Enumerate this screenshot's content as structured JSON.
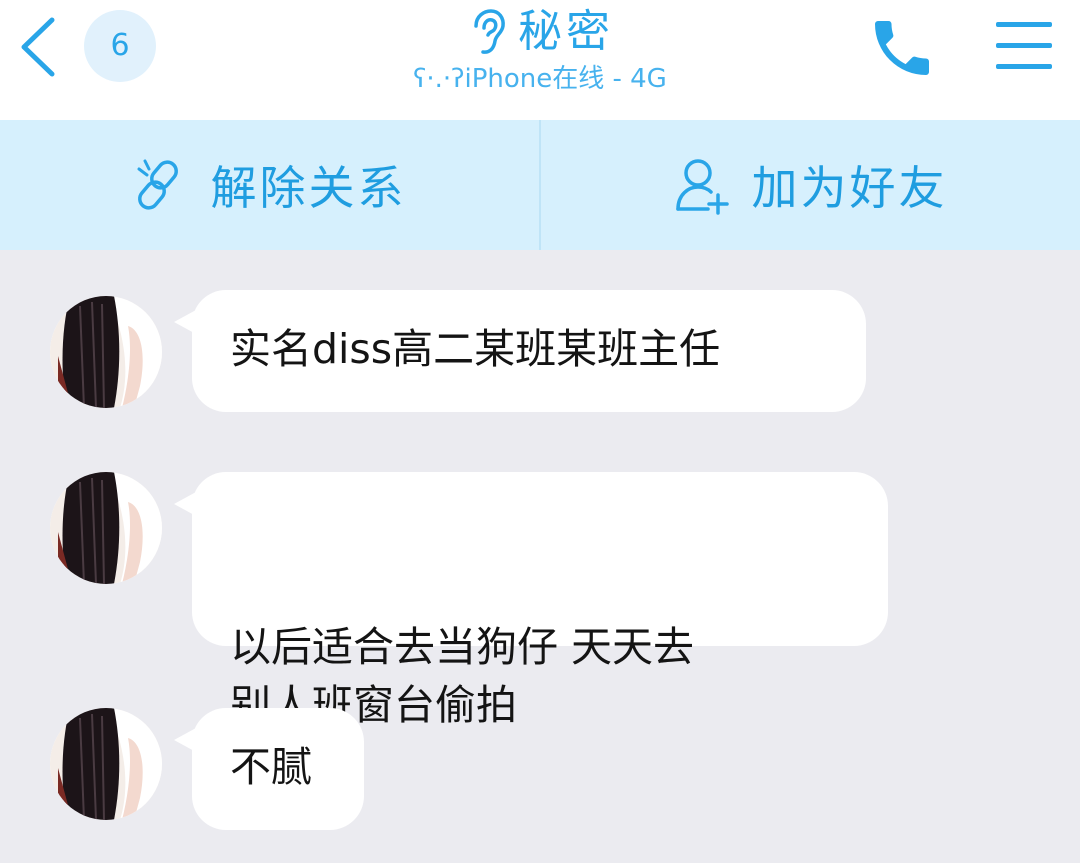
{
  "header": {
    "unread_count": "6",
    "title": "秘密",
    "status": "ʕ·.·ʔiPhone在线 - 4G",
    "accent_color": "#29a5e8",
    "icons": {
      "back": "chevron-left-icon",
      "title": "ear-icon",
      "call": "phone-icon",
      "menu": "hamburger-menu-icon"
    }
  },
  "actions": [
    {
      "label": "解除关系",
      "icon": "broken-link-icon"
    },
    {
      "label": "加为好友",
      "icon": "add-friend-icon"
    }
  ],
  "messages": [
    {
      "text": "实名diss高二某班某班主任"
    },
    {
      "text": "以后适合去当狗仔 天天去\n别人班窗台偷拍"
    },
    {
      "text": "不腻"
    }
  ]
}
